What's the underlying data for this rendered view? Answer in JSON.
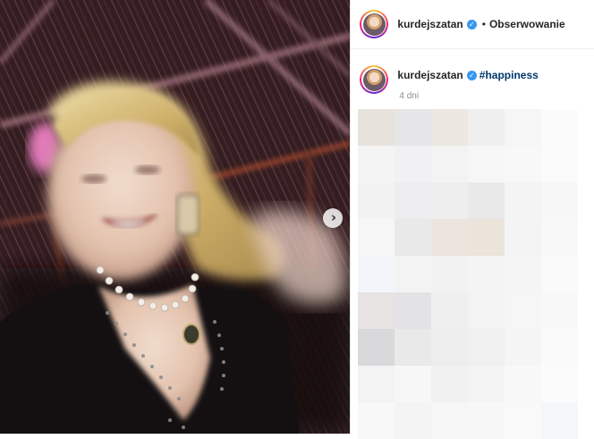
{
  "header": {
    "username": "kurdejszatan",
    "separator": "•",
    "follow_label": "Obserwowanie"
  },
  "caption": {
    "username": "kurdejszatan",
    "text": "#happiness",
    "time": "4 dni"
  },
  "photo": {
    "next_icon": "chevron-right-icon"
  },
  "icons": {
    "verified": "verified-badge-icon",
    "verified_color": "#3897f0"
  },
  "colors": {
    "username": "#262626",
    "hashtag": "#00376b",
    "time": "#8e8e8e"
  },
  "comments_blur_tints": [
    [
      "#e8e2dd",
      "#e6e6e8",
      "#ece7e1",
      "#efefef",
      "#f6f6f6",
      "#fbfbfb"
    ],
    [
      "#f4f4f4",
      "#f1f1f3",
      "#f3f3f3",
      "#f6f6f6",
      "#f8f8f8",
      "#fbfbfb"
    ],
    [
      "#f2f2f2",
      "#ededef",
      "#eeeeee",
      "#e9e9e9",
      "#f4f4f4",
      "#f7f7f7"
    ],
    [
      "#f6f6f6",
      "#e9e9ea",
      "#ebe5de",
      "#eae4da",
      "#f4f4f4",
      "#f8f8f8"
    ],
    [
      "#f2f6fb",
      "#f3f3f3",
      "#f2f2f2",
      "#f4f4f4",
      "#f5f5f5",
      "#fafafa"
    ],
    [
      "#e7e3e2",
      "#e3e3e5",
      "#efefef",
      "#f3f3f3",
      "#f6f6f6",
      "#f8f8f8"
    ],
    [
      "#d9d9db",
      "#e9e9e9",
      "#ededed",
      "#f0f0f0",
      "#f5f5f5",
      "#fafafa"
    ],
    [
      "#f3f3f3",
      "#f7f7f7",
      "#f1f1f1",
      "#f4f4f4",
      "#f8f8f8",
      "#fbfbfb"
    ],
    [
      "#f8f8f8",
      "#f4f4f4",
      "#f6f6f6",
      "#f7f7f7",
      "#f9f9f9",
      "#f3f7fa"
    ]
  ]
}
